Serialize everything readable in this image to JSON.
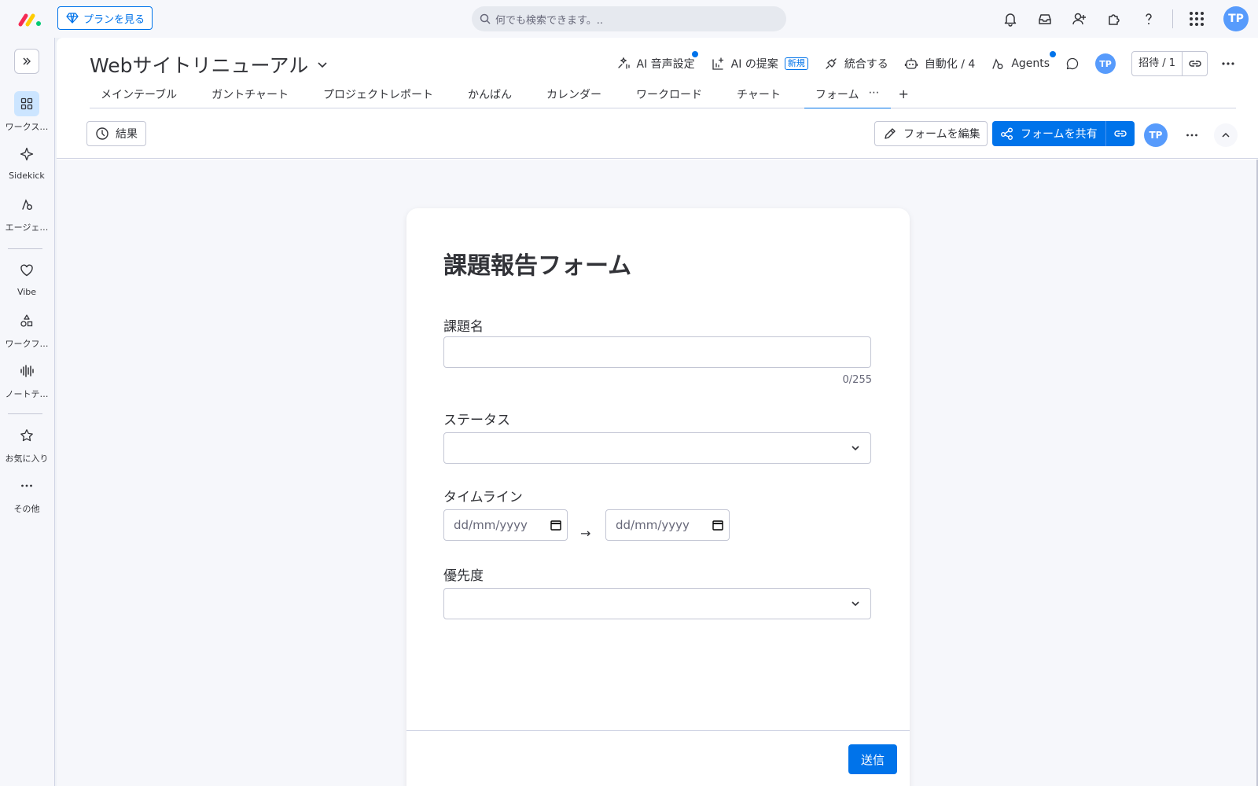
{
  "topbar": {
    "plan_button": "プランを見る",
    "search_placeholder": "何でも検索できます。..",
    "avatar_initials": "TP"
  },
  "sidebar": {
    "items": [
      {
        "label": "ワークス…",
        "icon": "grid-icon"
      },
      {
        "label": "Sidekick",
        "icon": "sparkle-icon"
      },
      {
        "label": "エージェ…",
        "icon": "agent-icon"
      },
      {
        "label": "Vibe",
        "icon": "heart-icon"
      },
      {
        "label": "ワークフ…",
        "icon": "workflow-icon"
      },
      {
        "label": "ノートテ…",
        "icon": "soundwave-icon"
      },
      {
        "label": "お気に入り",
        "icon": "star-icon"
      },
      {
        "label": "その他",
        "icon": "more-icon"
      }
    ]
  },
  "board": {
    "title": "Webサイトリニューアル",
    "actions": {
      "ai_voice": "AI 音声設定",
      "ai_suggest": "AI の提案",
      "new_badge": "新規",
      "integrate": "統合する",
      "automate": "自動化 / 4",
      "agents": "Agents",
      "avatar_initials": "TP",
      "invite": "招待 / 1"
    },
    "tabs": [
      "メインテーブル",
      "ガントチャート",
      "プロジェクトレポート",
      "かんばん",
      "カレンダー",
      "ワークロード",
      "チャート",
      "フォーム"
    ],
    "tab_add": "+",
    "tab_more": "⋯"
  },
  "toolbar": {
    "results": "結果",
    "edit_form": "フォームを編集",
    "share_form": "フォームを共有",
    "avatar_initials": "TP"
  },
  "form": {
    "title": "課題報告フォーム",
    "fields": {
      "name_label": "課題名",
      "name_counter": "0/255",
      "status_label": "ステータス",
      "timeline_label": "タイムライン",
      "date_placeholder": "dd/mm/yyyy",
      "date_arrow": "→",
      "priority_label": "優先度"
    },
    "submit": "送信"
  },
  "colors": {
    "accent": "#0073ea",
    "avatar": "#579bfc"
  }
}
